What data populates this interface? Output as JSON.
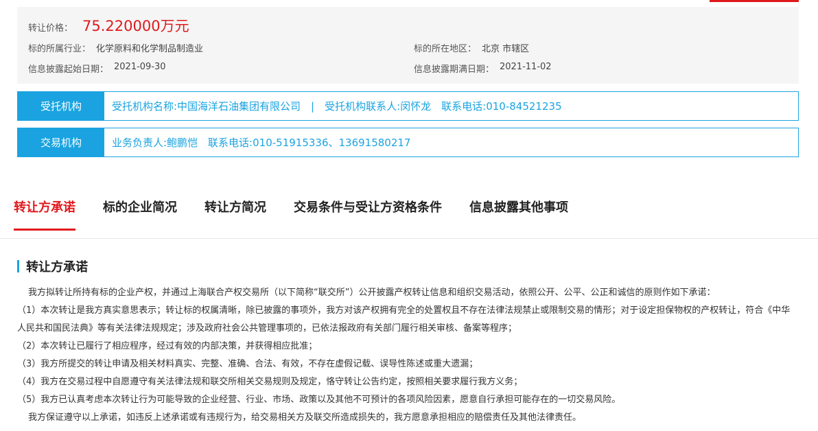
{
  "colors": {
    "accent_red": "#e0191d",
    "accent_blue": "#1aa3e0",
    "panel_gray": "#f5f5f5"
  },
  "info": {
    "price_label": "转让价格：",
    "price_value": "75.220000万元",
    "industry_label": "标的所属行业：",
    "industry_value": "化学原料和化学制品制造业",
    "region_label": "标的所在地区：",
    "region_value": "北京 市辖区",
    "start_label": "信息披露起始日期：",
    "start_value": "2021-09-30",
    "end_label": "信息披露期满日期：",
    "end_value": "2021-11-02"
  },
  "trustee": {
    "label": "受托机构",
    "text": "受托机构名称:中国海洋石油集团有限公司　|　受托机构联系人:闵怀龙　联系电话:010-84521235"
  },
  "exchange": {
    "label": "交易机构",
    "text": "业务负责人:鲍鹏恺　联系电话:010-51915336、13691580217"
  },
  "tabs": [
    {
      "label": "转让方承诺"
    },
    {
      "label": "标的企业简况"
    },
    {
      "label": "转让方简况"
    },
    {
      "label": "交易条件与受让方资格条件"
    },
    {
      "label": "信息披露其他事项"
    }
  ],
  "section": {
    "title": "转让方承诺",
    "paragraphs": [
      "我方拟转让所持有标的企业产权，并通过上海联合产权交易所（以下简称“联交所”）公开披露产权转让信息和组织交易活动，依照公开、公平、公正和诚信的原则作如下承诺：",
      "（1）本次转让是我方真实意思表示；转让标的权属清晰，除已披露的事项外，我方对该产权拥有完全的处置权且不存在法律法规禁止或限制交易的情形；对于设定担保物权的产权转让，符合《中华人民共和国民法典》等有关法律法规规定；涉及政府社会公共管理事项的，已依法报政府有关部门履行相关审核、备案等程序；",
      "（2）本次转让已履行了相应程序，经过有效的内部决策，并获得相应批准；",
      "（3）我方所提交的转让申请及相关材料真实、完整、准确、合法、有效，不存在虚假记载、误导性陈述或重大遗漏；",
      "（4）我方在交易过程中自愿遵守有关法律法规和联交所相关交易规则及规定，恪守转让公告约定，按照相关要求履行我方义务；",
      "（5）我方已认真考虑本次转让行为可能导致的企业经营、行业、市场、政策以及其他不可预计的各项风险因素，愿意自行承担可能存在的一切交易风险。",
      "我方保证遵守以上承诺，如违反上述承诺或有违规行为，给交易相关方及联交所造成损失的，我方愿意承担相应的赔偿责任及其他法律责任。"
    ]
  }
}
